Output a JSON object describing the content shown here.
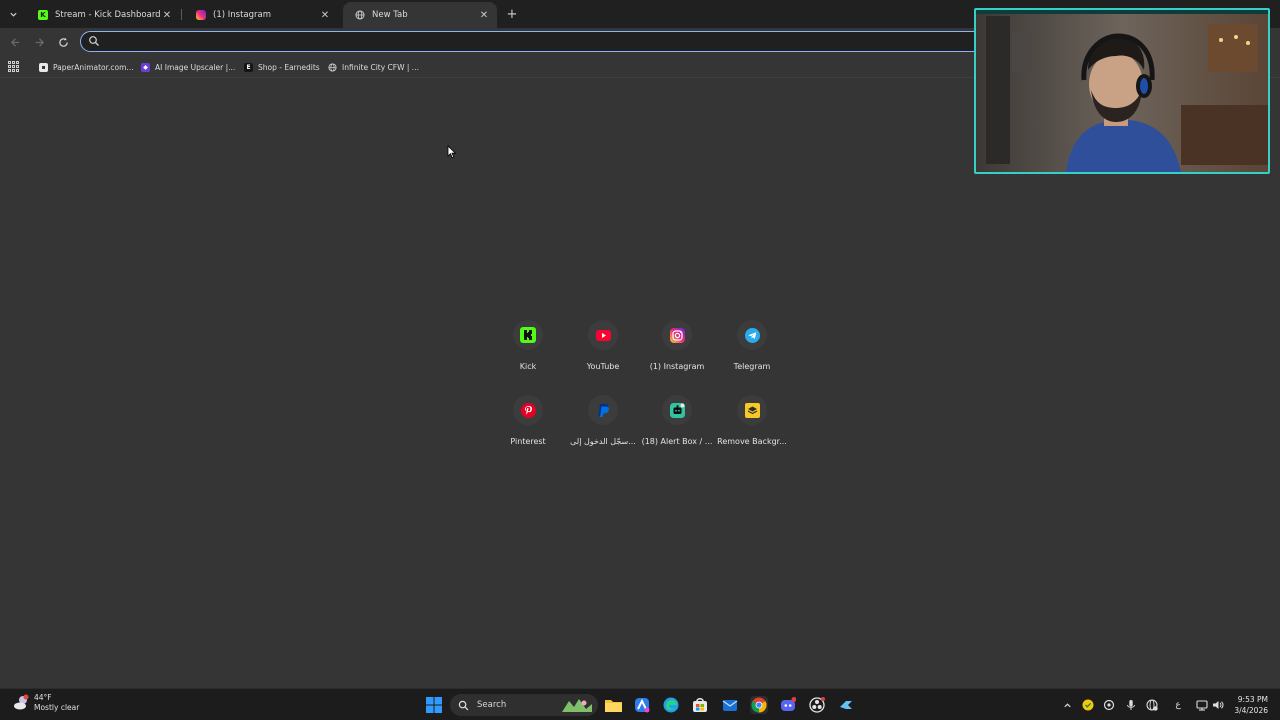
{
  "tabs": [
    {
      "title": "Stream - Kick Dashboard",
      "favicon": "kick-icon",
      "active": false
    },
    {
      "title": "(1) Instagram",
      "favicon": "instagram-icon",
      "active": false
    },
    {
      "title": "New Tab",
      "favicon": "globe-icon",
      "active": true
    }
  ],
  "new_tab_label": "+",
  "omnibox": {
    "value": "",
    "placeholder": ""
  },
  "bookmarks": [
    {
      "label": "PaperAnimator.com...",
      "icon": "paperanimator-icon"
    },
    {
      "label": "AI Image Upscaler |...",
      "icon": "upscaler-icon"
    },
    {
      "label": "Shop - Earnedits",
      "icon": "earnedits-icon"
    },
    {
      "label": "Infinite City CFW | ...",
      "icon": "globe-icon"
    }
  ],
  "shortcuts": [
    {
      "label": "Kick",
      "icon": "kick-icon",
      "color": "#53fc18"
    },
    {
      "label": "YouTube",
      "icon": "youtube-icon",
      "color": "#ff0033"
    },
    {
      "label": "(1) Instagram",
      "icon": "instagram-icon",
      "color": "#e1306c"
    },
    {
      "label": "Telegram",
      "icon": "telegram-icon",
      "color": "#2aabee"
    },
    {
      "label": "Pinterest",
      "icon": "pinterest-icon",
      "color": "#e60023"
    },
    {
      "label": "سجّل الدخول إلى...",
      "icon": "paypal-icon",
      "color": "#0070e0"
    },
    {
      "label": "(18) Alert Box / ...",
      "icon": "alertbox-icon",
      "color": "#31c3a2"
    },
    {
      "label": "Remove Backgr...",
      "icon": "removebg-icon",
      "color": "#f6c927"
    }
  ],
  "taskbar": {
    "weather_temp": "44°F",
    "weather_desc": "Mostly clear",
    "search_label": "Search",
    "time": "9:53 PM",
    "date": "3/4/2026",
    "lang": "ع"
  },
  "colors": {
    "page_bg": "#353535",
    "tabstrip_bg": "#202020",
    "omnibox_focus": "#8ab4f8",
    "webcam_border": "#35d0c8"
  }
}
